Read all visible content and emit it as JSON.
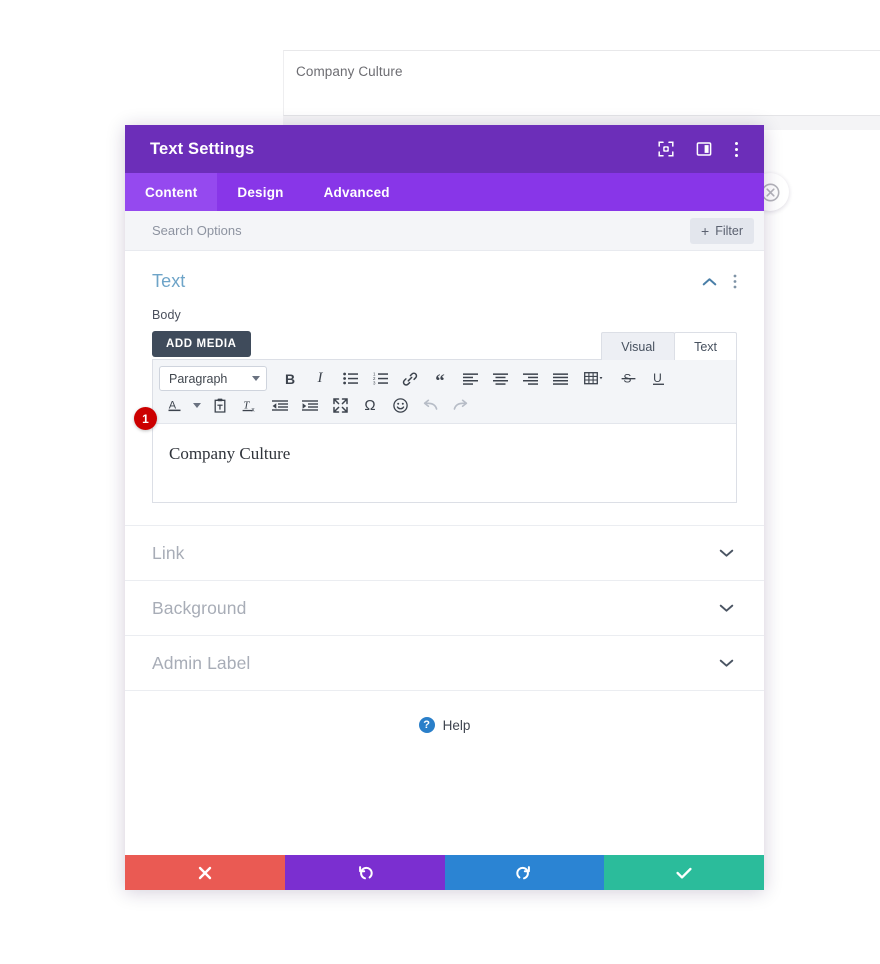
{
  "background": {
    "card_text": "Company Culture",
    "close_button_icon": "close-circle-icon"
  },
  "modal": {
    "title": "Text Settings",
    "header_icons": [
      {
        "name": "focus-target-icon",
        "label": "Focus"
      },
      {
        "name": "panel-layout-icon",
        "label": "Layout"
      },
      {
        "name": "more-vertical-icon",
        "label": "More options"
      }
    ],
    "tabs": [
      {
        "label": "Content",
        "active": true
      },
      {
        "label": "Design",
        "active": false
      },
      {
        "label": "Advanced",
        "active": false
      }
    ],
    "search": {
      "placeholder": "Search Options",
      "value": ""
    },
    "filter_button": {
      "label": "Filter",
      "plus": "+"
    },
    "section": {
      "title": "Text",
      "collapse_icon": "chevron-up-icon",
      "more_icon": "more-vertical-icon",
      "field_label": "Body",
      "add_media_label": "ADD MEDIA",
      "editor_tabs": [
        {
          "label": "Visual",
          "active": true
        },
        {
          "label": "Text",
          "active": false
        }
      ],
      "editor": {
        "format_select": "Paragraph",
        "content": "Company Culture",
        "badge": "1",
        "toolbar_row1": [
          {
            "name": "bold-icon",
            "glyph": "B"
          },
          {
            "name": "italic-icon",
            "glyph": "I"
          },
          {
            "name": "bulleted-list-icon",
            "glyph": ""
          },
          {
            "name": "numbered-list-icon",
            "glyph": ""
          },
          {
            "name": "link-icon",
            "glyph": ""
          },
          {
            "name": "blockquote-icon",
            "glyph": "“"
          },
          {
            "name": "align-left-icon",
            "glyph": ""
          },
          {
            "name": "align-center-icon",
            "glyph": ""
          },
          {
            "name": "align-right-icon",
            "glyph": ""
          },
          {
            "name": "align-justify-icon",
            "glyph": ""
          },
          {
            "name": "table-icon",
            "glyph": ""
          },
          {
            "name": "strikethrough-icon",
            "glyph": "S"
          },
          {
            "name": "underline-icon",
            "glyph": "U"
          }
        ],
        "toolbar_row2": [
          {
            "name": "text-color-icon",
            "glyph": "A"
          },
          {
            "name": "paste-as-text-icon",
            "glyph": ""
          },
          {
            "name": "clear-formatting-icon",
            "glyph": ""
          },
          {
            "name": "outdent-icon",
            "glyph": ""
          },
          {
            "name": "indent-icon",
            "glyph": ""
          },
          {
            "name": "fullscreen-icon",
            "glyph": ""
          },
          {
            "name": "special-character-icon",
            "glyph": "Ω"
          },
          {
            "name": "emoji-icon",
            "glyph": "☺"
          },
          {
            "name": "undo-icon",
            "glyph": ""
          },
          {
            "name": "redo-icon",
            "glyph": ""
          }
        ]
      }
    },
    "accordions": [
      {
        "label": "Link",
        "icon": "chevron-down-icon"
      },
      {
        "label": "Background",
        "icon": "chevron-down-icon"
      },
      {
        "label": "Admin Label",
        "icon": "chevron-down-icon"
      }
    ],
    "help": {
      "label": "Help",
      "icon_glyph": "?"
    },
    "footer_buttons": [
      {
        "name": "cancel-button",
        "icon": "close-icon",
        "glyph": "✖",
        "color": "#ea5a53"
      },
      {
        "name": "undo-button",
        "icon": "undo-icon",
        "glyph": "↺",
        "color": "#7b2fd0"
      },
      {
        "name": "redo-button",
        "icon": "redo-icon",
        "glyph": "↻",
        "color": "#2b84d3"
      },
      {
        "name": "save-button",
        "icon": "check-icon",
        "glyph": "✔",
        "color": "#2bbc9b"
      }
    ]
  },
  "colors": {
    "header_purple": "#6c2eb9",
    "tabbar_purple": "#8836e8",
    "tab_active_purple": "#9549ef",
    "section_title_blue": "#6ea4c8",
    "badge_red": "#cc0000",
    "add_media_slate": "#3f4b5b"
  }
}
